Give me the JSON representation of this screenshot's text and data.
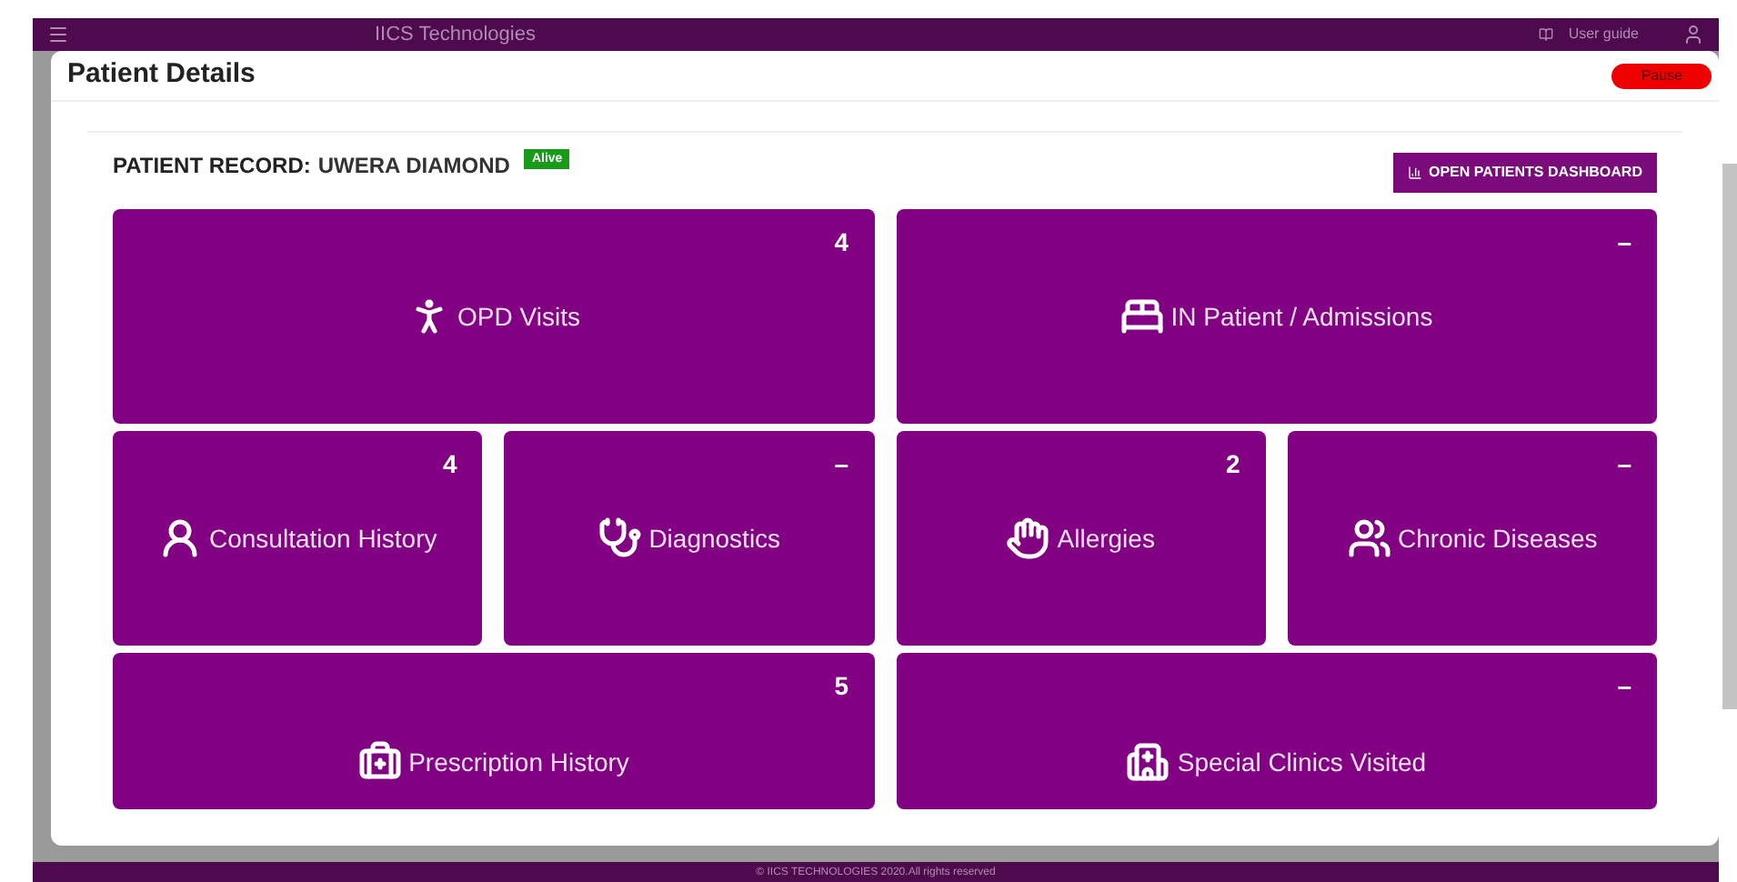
{
  "top_bar": {
    "brand": "IICS Technologies",
    "user_guide": "User guide"
  },
  "modal": {
    "title": "Patient Details",
    "pause_button": "Pause"
  },
  "patient": {
    "label": "PATIENT RECORD:",
    "name": "UWERA DIAMOND",
    "status": "Alive",
    "dashboard_button": "OPEN PATIENTS DASHBOARD"
  },
  "tiles": [
    {
      "kind": "wide",
      "label": "OPD Visits",
      "count": "4"
    },
    {
      "kind": "wide",
      "label": "IN Patient / Admissions",
      "count": "–"
    },
    {
      "kind": "half",
      "label": "Consultation History",
      "count": "4"
    },
    {
      "kind": "half",
      "label": "Diagnostics",
      "count": "–"
    },
    {
      "kind": "half",
      "label": "Allergies",
      "count": "2"
    },
    {
      "kind": "half",
      "label": "Chronic Diseases",
      "count": "–"
    },
    {
      "kind": "short",
      "label": "Prescription History",
      "count": "5"
    },
    {
      "kind": "short",
      "label": "Special Clinics Visited",
      "count": "–"
    }
  ],
  "footer": "© IICS TECHNOLOGIES 2020.All rights reserved"
}
